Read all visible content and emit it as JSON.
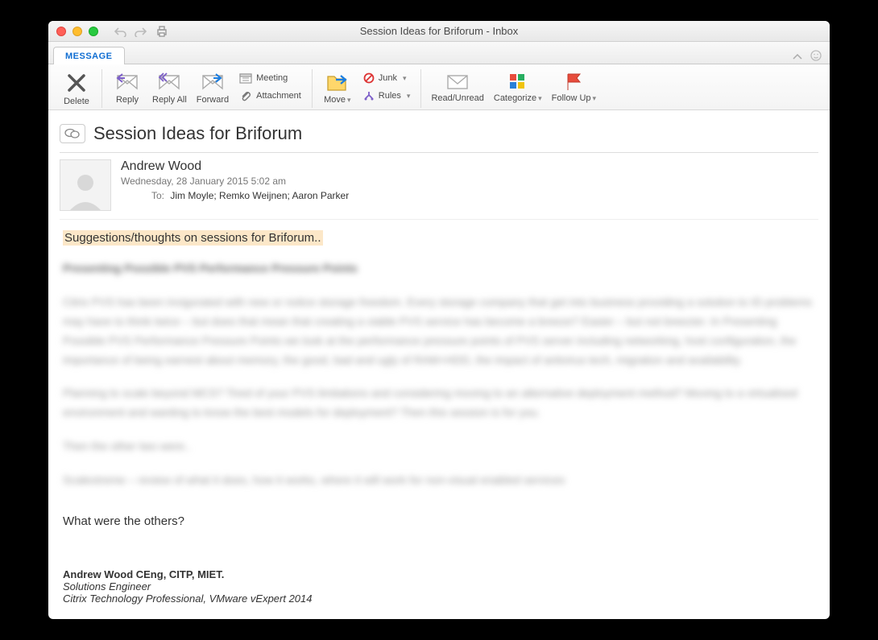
{
  "window": {
    "title": "Session Ideas for Briforum - Inbox"
  },
  "tabs": {
    "active": "MESSAGE"
  },
  "ribbon": {
    "delete": "Delete",
    "reply": "Reply",
    "reply_all": "Reply All",
    "forward": "Forward",
    "meeting": "Meeting",
    "attachment": "Attachment",
    "move": "Move",
    "junk": "Junk",
    "rules": "Rules",
    "read_unread": "Read/Unread",
    "categorize": "Categorize",
    "follow_up": "Follow Up"
  },
  "message": {
    "subject": "Session Ideas for Briforum",
    "sender": "Andrew Wood",
    "date": "Wednesday, 28 January 2015 5:02 am",
    "to_label": "To:",
    "recipients": "Jim Moyle;   Remko Weijnen;   Aaron Parker",
    "highlight": "Suggestions/thoughts on sessions for Briforum..",
    "blurred_heading": "Presenting Possible PVS Performance Pressure Points",
    "blurred_p1": "Citrix PVS has been invigorated with new or notice storage freedom. Every storage company that get into business providing a solution to ID problems may have to think twice – but does that mean that creating a viable PVS service has become a breeze? Easier – but not breezier. In Presenting Possible PVS Performance Pressure Points we look at the performance pressure points of PVS server including networking, host configuration, the importance of being earnest about memory, the good, bad and ugly of RAM+HDD, the impact of antivirus tech, migration and availability.",
    "blurred_p2": "Planning to scale beyond MCS? Tired of your PVS limitations and considering moving to an alternative deployment method?  Moving to a virtualised environment and wanting to know the best models for deployment? Then this session is for you.",
    "blurred_p3": "Then the other two were..",
    "blurred_p4": "Scalextreme – review of what it does, how it works, where it will work for non-visual enabled services",
    "question": "What were the others?",
    "signature": {
      "name": "Andrew Wood CEng, CITP, MIET.",
      "title1": "Solutions Engineer",
      "title2": "Citrix Technology Professional, VMware vExpert 2014"
    }
  }
}
